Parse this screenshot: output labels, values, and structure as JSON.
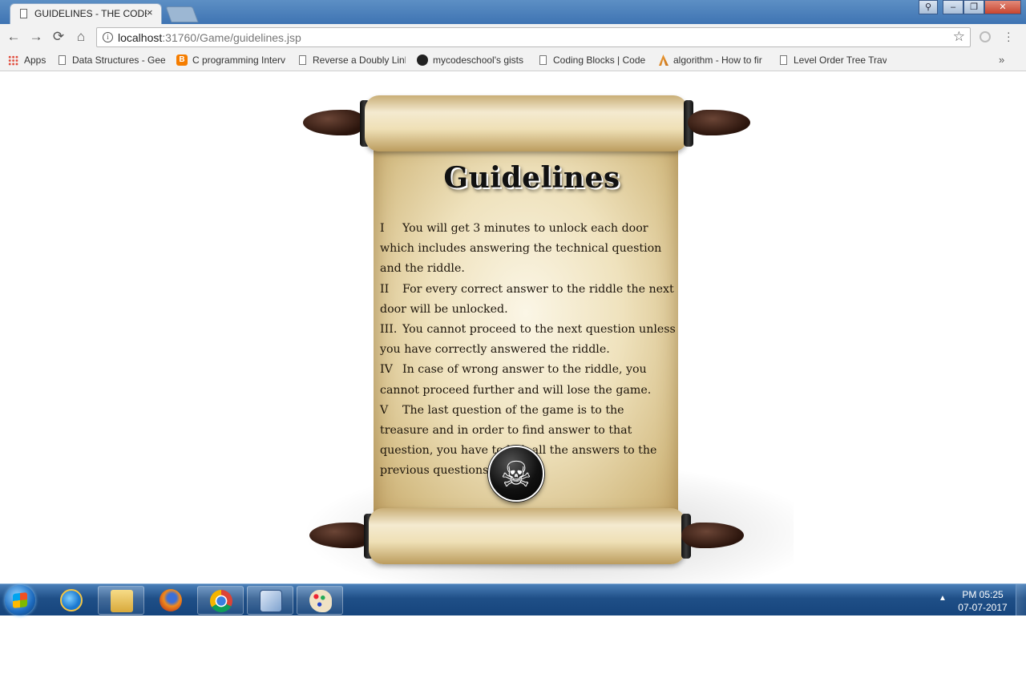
{
  "browser": {
    "tab_title": "GUIDELINES - THE CODE",
    "tab_close": "×",
    "window_controls": {
      "user": "⚲",
      "minimize": "–",
      "maximize": "❐",
      "close": "✕"
    },
    "url_host": "localhost",
    "url_rest": ":31760/Game/guidelines.jsp",
    "nav": {
      "back": "←",
      "forward": "→",
      "reload": "⟳",
      "home": "⌂",
      "star": "☆"
    }
  },
  "bookmarks": [
    {
      "label": "Apps",
      "icon": "apps-grid-icon"
    },
    {
      "label": "Data Structures - Gee",
      "icon": "page-icon"
    },
    {
      "label": "C programming Interv",
      "icon": "blogger-icon"
    },
    {
      "label": "Reverse a Doubly Link",
      "icon": "page-icon"
    },
    {
      "label": "mycodeschool's gists",
      "icon": "github-icon"
    },
    {
      "label": "Coding Blocks | Code",
      "icon": "page-icon"
    },
    {
      "label": "algorithm - How to fir",
      "icon": "stackoverflow-icon"
    },
    {
      "label": "Level Order Tree Trave",
      "icon": "page-icon"
    }
  ],
  "bookmarks_more": "»",
  "page": {
    "heading": "Guidelines",
    "rules": [
      {
        "num": "I",
        "text": "You will get 3 minutes to unlock each door which includes answering the technical question and the riddle."
      },
      {
        "num": "II",
        "text": "For every correct answer to the riddle the next door will be unlocked."
      },
      {
        "num": "III.",
        "text": "You cannot proceed to the next question unless you have correctly answered the riddle."
      },
      {
        "num": "IV",
        "text": "In case of wrong answer to the riddle, you cannot proceed further and will lose the game."
      },
      {
        "num": "V",
        "text": "The last question of the game is to the treasure and in order to find answer to that question, you have to link all the answers to the previous questions."
      }
    ],
    "skull_glyph": "☠"
  },
  "taskbar": {
    "pinned": [
      "internet-explorer-icon",
      "file-explorer-icon",
      "firefox-icon",
      "chrome-icon",
      "virtualbox-icon",
      "paint-icon"
    ],
    "tray_arrow": "▲",
    "time": "PM 05:25",
    "date": "07-07-2017"
  },
  "colors": {
    "titlebar": "#3f74b3",
    "parchment": "#efe2bd",
    "taskbar": "#1f4f87"
  }
}
